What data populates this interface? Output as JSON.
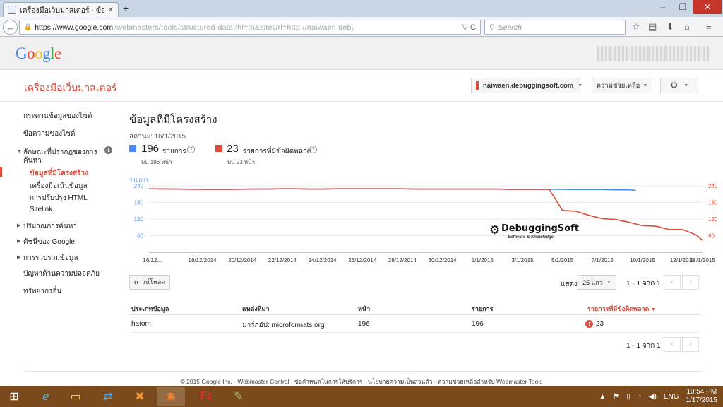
{
  "browser": {
    "tab_title": "เครื่องมือเว็บมาสเตอร์ - ข้อมูล...",
    "url_host": "https://www.google.com",
    "url_rest": "/webmasters/tools/structured-data?hl=th&siteUrl=http://naiwaen.debuggingsoft.com/",
    "search_placeholder": "Search",
    "icons": [
      "back-arrow-icon",
      "lock-icon",
      "reload-icon",
      "search-icon",
      "star-icon",
      "clipboard-icon",
      "download-icon",
      "home-icon",
      "menu-icon"
    ]
  },
  "google": {
    "logo": "Google"
  },
  "webmaster": {
    "title": "เครื่องมือเว็บมาสเตอร์",
    "site": "naiwaen.debuggingsoft.com",
    "help": "ความช่วยเหลือ"
  },
  "sidebar": {
    "items": [
      {
        "label": "กระดานข้อมูลของไซต์"
      },
      {
        "label": "ข้อความของไซต์"
      },
      {
        "label": "ลักษณะที่ปรากฏของการ"
      },
      {
        "label": "ค้นหา"
      },
      {
        "label": "ข้อมูลที่มีโครงสร้าง"
      },
      {
        "label": "เครื่องมือเน้นข้อมูล"
      },
      {
        "label": "การปรับปรุง HTML"
      },
      {
        "label": "Sitelink"
      },
      {
        "label": "ปริมาณการค้นหา"
      },
      {
        "label": "ดัชนีของ Google"
      },
      {
        "label": "การรวบรวมข้อมูล"
      },
      {
        "label": "ปัญหาด้านความปลอดภัย"
      },
      {
        "label": "ทรัพยากรอื่น"
      }
    ]
  },
  "main": {
    "title": "ข้อมูลที่มีโครงสร้าง",
    "status": "สถานะ: 16/1/2015",
    "items_count": "196",
    "items_label": "รายการ",
    "items_sub": "บน 196 หน้า",
    "errors_count": "23",
    "errors_label": "รายการที่มีข้อผิดพลาด",
    "errors_sub": "บน 23 หน้า",
    "watermark": "DebuggingSoft",
    "watermark_sub": "Software & Knowledge",
    "download": "ดาวน์โหลด",
    "show_label": "แสดง",
    "rows_option": "25 แถว",
    "pagination": "1 - 1 จาก 1",
    "table": {
      "headers": [
        "ประเภทข้อมูล",
        "แหล่งที่มา",
        "หน้า",
        "รายการ",
        "รายการที่มีข้อผิดพลาด"
      ],
      "rows": [
        [
          "hatom",
          "มาร์กอัป: microformats.org",
          "196",
          "196",
          "23"
        ]
      ]
    }
  },
  "chart_data": {
    "type": "line",
    "ylabel": "รายการ",
    "ylim": [
      0,
      260
    ],
    "yticks_left": [
      "240",
      "180",
      "120",
      "60"
    ],
    "yticks_right": [
      "240",
      "180",
      "120",
      "60"
    ],
    "x": [
      "16/12...",
      "18/12/2014",
      "20/12/2014",
      "22/12/2014",
      "24/12/2014",
      "26/12/2014",
      "28/12/2014",
      "30/12/2014",
      "1/1/2015",
      "3/1/2015",
      "5/1/2015",
      "7/1/2015",
      "10/1/2015",
      "12/1/2015",
      "14/1/2015"
    ],
    "series": [
      {
        "name": "รายการ",
        "color": "#4a8af4",
        "points": [
          [
            0,
            229
          ],
          [
            4,
            228
          ],
          [
            8,
            227
          ],
          [
            12,
            227
          ],
          [
            16,
            228
          ],
          [
            20,
            229
          ],
          [
            22,
            229
          ],
          [
            24,
            228
          ],
          [
            26,
            228
          ],
          [
            28,
            229
          ],
          [
            30,
            229
          ],
          [
            32,
            229
          ],
          [
            34,
            229
          ],
          [
            36,
            229
          ],
          [
            38,
            229
          ],
          [
            40,
            228
          ],
          [
            42,
            228
          ],
          [
            44,
            228
          ],
          [
            46,
            228
          ],
          [
            48,
            228
          ],
          [
            50,
            228
          ],
          [
            52,
            228
          ],
          [
            54,
            227
          ],
          [
            56,
            227
          ],
          [
            58,
            227
          ],
          [
            60,
            227
          ],
          [
            62,
            227
          ],
          [
            64,
            226
          ],
          [
            66,
            226
          ],
          [
            68,
            226
          ],
          [
            70,
            225
          ],
          [
            72,
            225
          ],
          [
            73,
            223
          ]
        ]
      },
      {
        "name": "รายการที่มีข้อผิดพลาด",
        "color": "#dd4b39",
        "points": [
          [
            0,
            229
          ],
          [
            4,
            228
          ],
          [
            8,
            227
          ],
          [
            12,
            227
          ],
          [
            16,
            228
          ],
          [
            20,
            229
          ],
          [
            22,
            229
          ],
          [
            24,
            228
          ],
          [
            26,
            228
          ],
          [
            28,
            229
          ],
          [
            30,
            229
          ],
          [
            32,
            229
          ],
          [
            34,
            229
          ],
          [
            36,
            229
          ],
          [
            38,
            229
          ],
          [
            40,
            228
          ],
          [
            42,
            228
          ],
          [
            44,
            228
          ],
          [
            46,
            228
          ],
          [
            48,
            228
          ],
          [
            50,
            228
          ],
          [
            52,
            228
          ],
          [
            54,
            227
          ],
          [
            56,
            227
          ],
          [
            58,
            227
          ],
          [
            60,
            227
          ],
          [
            61,
            190
          ],
          [
            62,
            151
          ],
          [
            64,
            148
          ],
          [
            66,
            133
          ],
          [
            68,
            121
          ],
          [
            70,
            118
          ],
          [
            72,
            108
          ],
          [
            74,
            96
          ],
          [
            76,
            94
          ],
          [
            78,
            82
          ],
          [
            80,
            82
          ],
          [
            82,
            63
          ],
          [
            83,
            43
          ]
        ]
      }
    ]
  },
  "footer": "© 2015 Google Inc. - Webmaster Central - ข้อกำหนดในการให้บริการ - นโยบายความเป็นส่วนตัว - ความช่วยเหลือสำหรับ Webmaster Tools",
  "taskbar": {
    "apps": [
      "windows-start-icon",
      "internet-explorer-icon",
      "file-explorer-icon",
      "teamviewer-icon",
      "xampp-icon",
      "firefox-icon",
      "filezilla-icon",
      "notepad-plus-icon"
    ],
    "lang": "ENG",
    "time": "10:54 PM",
    "date": "1/17/2015"
  }
}
